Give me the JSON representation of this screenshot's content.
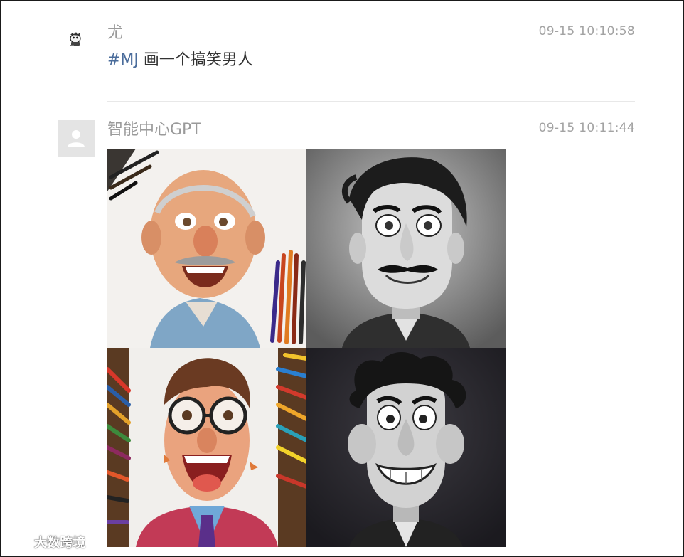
{
  "messages": [
    {
      "sender": "尤",
      "timestamp": "09-15 10:10:58",
      "tag": "#MJ",
      "text": " 画一个搞笑男人"
    },
    {
      "sender": "智能中心GPT",
      "timestamp": "09-15 10:11:44",
      "images": [
        {
          "icon": "caricature-old-man-colored-pencil"
        },
        {
          "icon": "caricature-mustache-man-grayscale"
        },
        {
          "icon": "caricature-glasses-man-colored-pencil"
        },
        {
          "icon": "caricature-wild-hair-man-grayscale"
        }
      ]
    }
  ],
  "watermark": {
    "text": "大数跨境"
  },
  "colors": {
    "tag": "#4a6c9b",
    "meta": "#9a9a9a",
    "text": "#333333",
    "divider": "#e8e8e8"
  }
}
